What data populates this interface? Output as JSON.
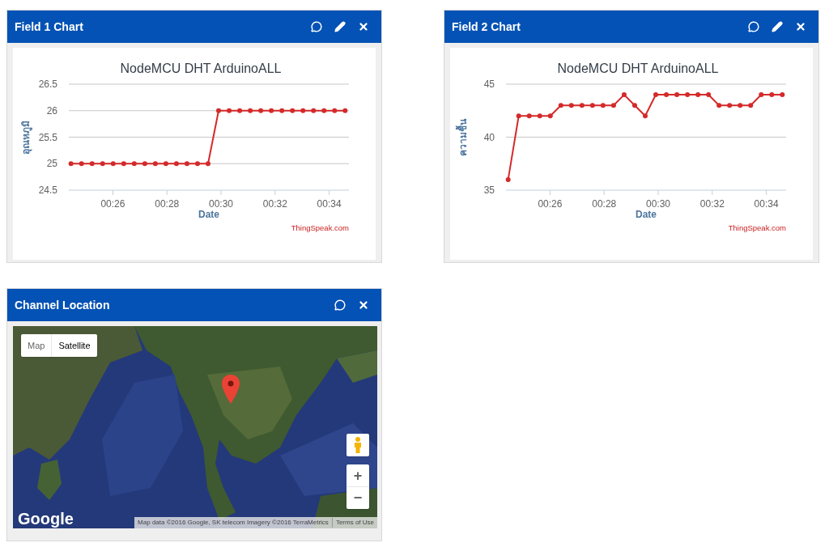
{
  "panels": [
    {
      "kind": "chart",
      "title": "Field 1 Chart",
      "actions": [
        {
          "kind": "comment"
        },
        {
          "kind": "edit"
        },
        {
          "kind": "close"
        }
      ],
      "credit": "ThingSpeak.com",
      "chart_data": {
        "type": "line",
        "title": "NodeMCU DHT ArduinoALL",
        "xlabel": "Date",
        "ylabel": "อุณหภูมิ",
        "x": [
          24.45,
          24.84,
          25.23,
          25.62,
          26.01,
          26.4,
          26.79,
          27.18,
          27.57,
          27.96,
          28.35,
          28.74,
          29.13,
          29.52,
          29.91,
          30.3,
          30.69,
          31.08,
          31.47,
          31.86,
          32.25,
          32.64,
          33.03,
          33.42,
          33.81,
          34.2,
          34.59
        ],
        "grid": true,
        "series": [
          {
            "color": "#d42a2a",
            "marker": true,
            "values": [
              25,
              25,
              25,
              25,
              25,
              25,
              25,
              25,
              25,
              25,
              25,
              25,
              25,
              25,
              26,
              26,
              26,
              26,
              26,
              26,
              26,
              26,
              26,
              26,
              26,
              26,
              26
            ]
          }
        ],
        "xlim": [
          24.37,
          34.73
        ],
        "ylim": [
          24.5,
          26.5
        ],
        "yticks": [
          24.5,
          25,
          25.5,
          26,
          26.5
        ],
        "xticks": [
          {
            "value": 26,
            "label": "00:26"
          },
          {
            "value": 28,
            "label": "00:28"
          },
          {
            "value": 30,
            "label": "00:30"
          },
          {
            "value": 32,
            "label": "00:32"
          },
          {
            "value": 34,
            "label": "00:34"
          }
        ]
      }
    },
    {
      "kind": "chart",
      "title": "Field 2 Chart",
      "actions": [
        {
          "kind": "comment"
        },
        {
          "kind": "edit"
        },
        {
          "kind": "close"
        }
      ],
      "credit": "ThingSpeak.com",
      "chart_data": {
        "type": "line",
        "title": "NodeMCU DHT ArduinoALL",
        "xlabel": "Date",
        "ylabel": "ความชื้น",
        "x": [
          24.45,
          24.84,
          25.23,
          25.62,
          26.01,
          26.4,
          26.79,
          27.18,
          27.57,
          27.96,
          28.35,
          28.74,
          29.13,
          29.52,
          29.91,
          30.3,
          30.69,
          31.08,
          31.47,
          31.86,
          32.25,
          32.64,
          33.03,
          33.42,
          33.81,
          34.2,
          34.59
        ],
        "grid": true,
        "series": [
          {
            "color": "#d42a2a",
            "marker": true,
            "values": [
              36,
              42,
              42,
              42,
              42,
              43,
              43,
              43,
              43,
              43,
              43,
              44,
              43,
              42,
              44,
              44,
              44,
              44,
              44,
              44,
              43,
              43,
              43,
              43,
              44,
              44,
              44
            ]
          }
        ],
        "xlim": [
          24.37,
          34.73
        ],
        "ylim": [
          35,
          45
        ],
        "yticks": [
          35,
          40,
          45
        ],
        "xticks": [
          {
            "value": 26,
            "label": "00:26"
          },
          {
            "value": 28,
            "label": "00:28"
          },
          {
            "value": 30,
            "label": "00:30"
          },
          {
            "value": 32,
            "label": "00:32"
          },
          {
            "value": 34,
            "label": "00:34"
          }
        ]
      }
    },
    {
      "kind": "map",
      "title": "Channel Location",
      "actions": [
        {
          "kind": "comment"
        },
        {
          "kind": "close"
        }
      ],
      "map": {
        "types": [
          {
            "label": "Map",
            "selected": false
          },
          {
            "label": "Satellite",
            "selected": true
          }
        ],
        "zoom": [
          "+",
          "−"
        ],
        "logo": "Google",
        "attribution": "Map data ©2016 Google, SK telecom Imagery ©2016 TerraMetrics",
        "terms": "Terms of Use"
      }
    }
  ]
}
